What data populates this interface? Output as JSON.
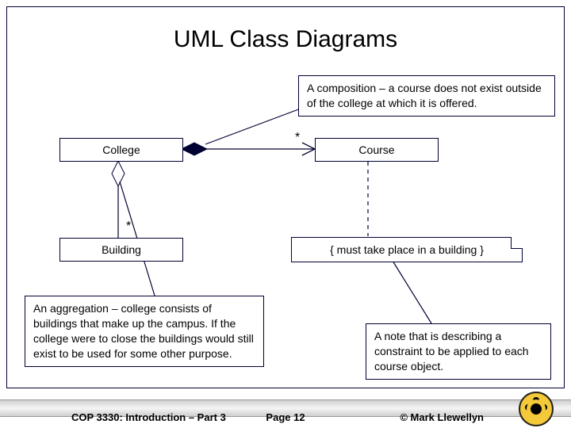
{
  "title": "UML Class Diagrams",
  "classes": {
    "college": "College",
    "course": "Course",
    "building": "Building"
  },
  "multiplicities": {
    "course": "*",
    "building": "*"
  },
  "notes": {
    "composition": "A composition – a course does not exist outside of the college at which it is offered.",
    "aggregation": "An aggregation – college consists of buildings that make up the campus.  If the college were to close the buildings would still exist to be used for some other purpose.",
    "constraint_box": "{ must take place in a building }",
    "constraint_desc": "A note that is describing a constraint to be applied to each course object."
  },
  "footer": {
    "left": "COP 3330:  Introduction – Part 3",
    "mid": "Page 12",
    "right": "© Mark Llewellyn"
  }
}
